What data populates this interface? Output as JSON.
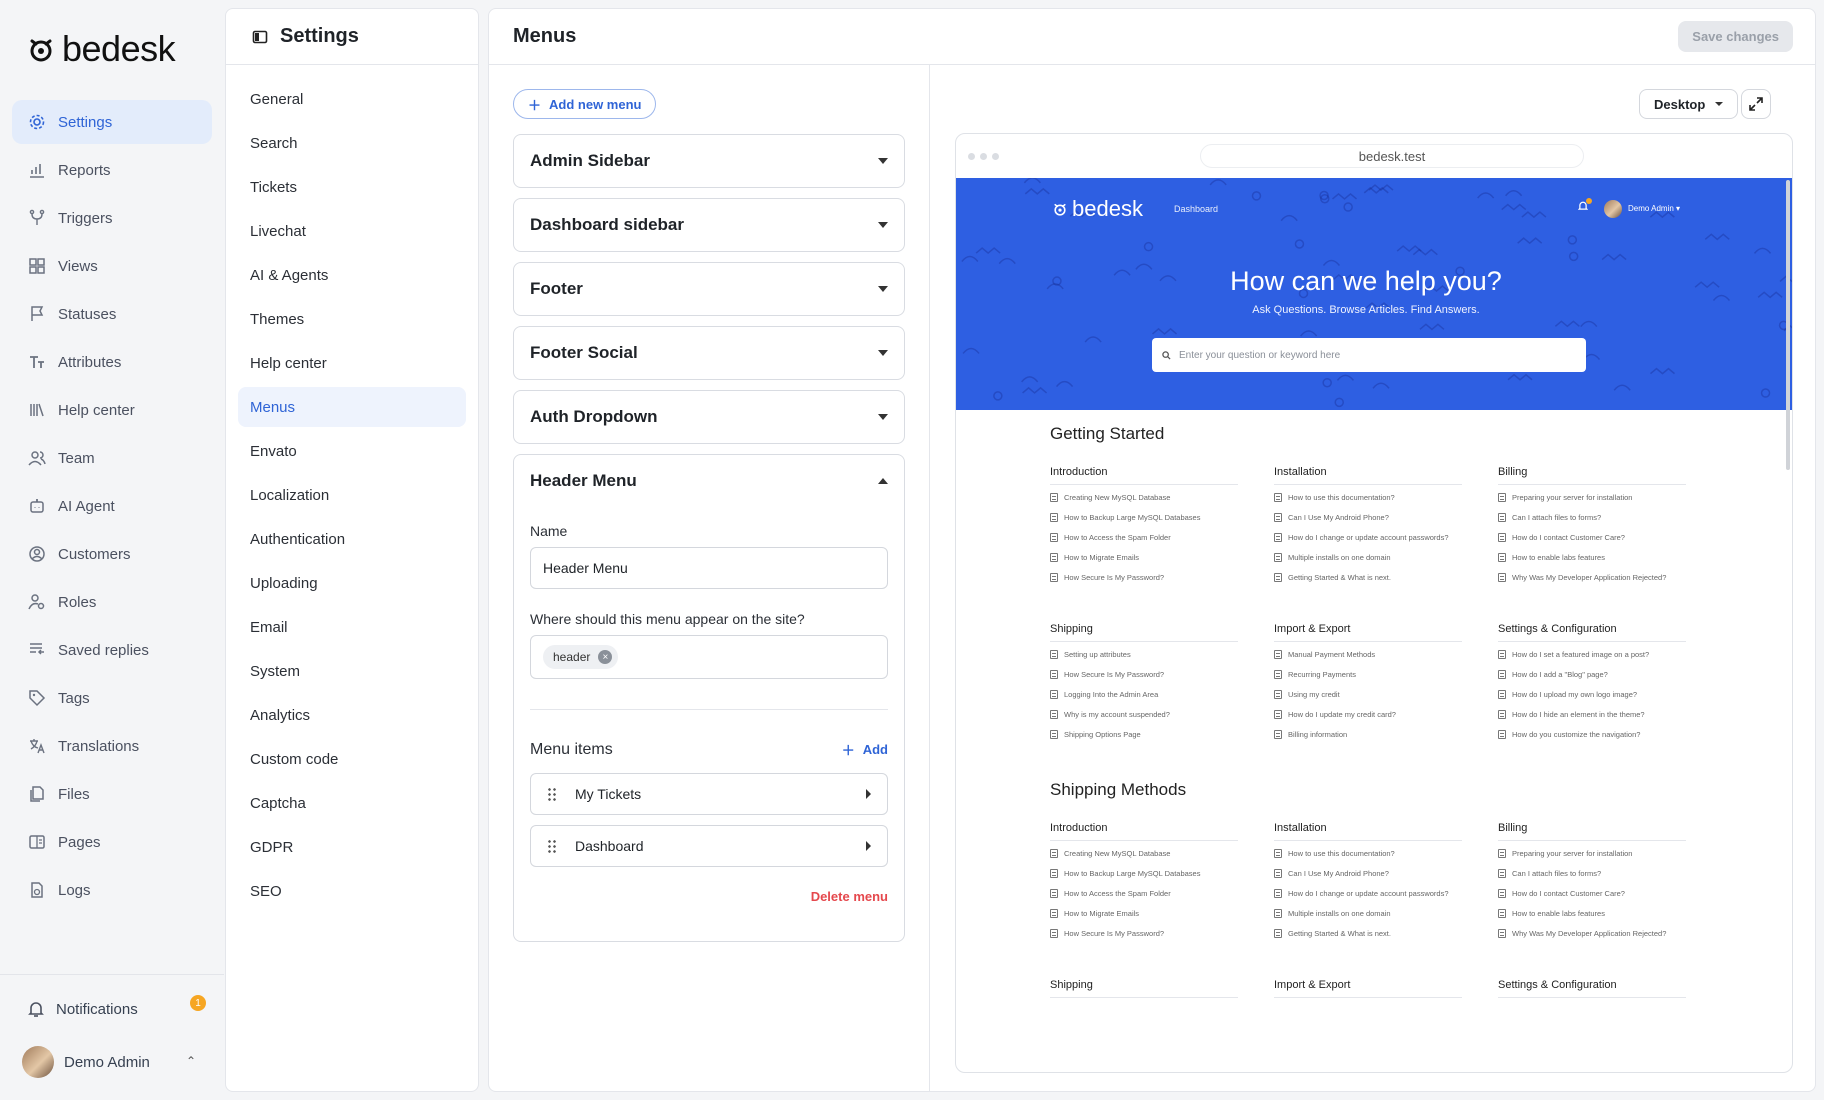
{
  "brand": {
    "name": "bedesk"
  },
  "nav": {
    "items": [
      {
        "label": "Settings",
        "icon": "gear-icon",
        "active": true
      },
      {
        "label": "Reports",
        "icon": "chart-icon"
      },
      {
        "label": "Triggers",
        "icon": "branch-icon"
      },
      {
        "label": "Views",
        "icon": "grid-icon"
      },
      {
        "label": "Statuses",
        "icon": "flag-icon"
      },
      {
        "label": "Attributes",
        "icon": "text-size-icon"
      },
      {
        "label": "Help center",
        "icon": "books-icon"
      },
      {
        "label": "Team",
        "icon": "users-icon"
      },
      {
        "label": "AI Agent",
        "icon": "robot-icon"
      },
      {
        "label": "Customers",
        "icon": "user-circle-icon"
      },
      {
        "label": "Roles",
        "icon": "user-gear-icon"
      },
      {
        "label": "Saved replies",
        "icon": "reply-icon"
      },
      {
        "label": "Tags",
        "icon": "tag-icon"
      },
      {
        "label": "Translations",
        "icon": "translate-icon"
      },
      {
        "label": "Files",
        "icon": "files-icon"
      },
      {
        "label": "Pages",
        "icon": "page-icon"
      },
      {
        "label": "Logs",
        "icon": "logs-icon"
      }
    ],
    "notifications": {
      "label": "Notifications",
      "count": "1"
    },
    "user": {
      "name": "Demo Admin"
    }
  },
  "settings": {
    "title": "Settings",
    "items": [
      "General",
      "Search",
      "Tickets",
      "Livechat",
      "AI & Agents",
      "Themes",
      "Help center",
      "Menus",
      "Envato",
      "Localization",
      "Authentication",
      "Uploading",
      "Email",
      "System",
      "Analytics",
      "Custom code",
      "Captcha",
      "GDPR",
      "SEO"
    ],
    "active": "Menus"
  },
  "main": {
    "title": "Menus",
    "save_label": "Save changes",
    "add_menu_label": "Add new menu",
    "menus": [
      "Admin Sidebar",
      "Dashboard sidebar",
      "Footer",
      "Footer Social",
      "Auth Dropdown"
    ],
    "open_menu": {
      "title": "Header Menu",
      "name_label": "Name",
      "name_value": "Header Menu",
      "position_label": "Where should this menu appear on the site?",
      "position_tag": "header",
      "items_label": "Menu items",
      "add_label": "Add",
      "items": [
        "My Tickets",
        "Dashboard"
      ],
      "delete_label": "Delete menu"
    }
  },
  "preview": {
    "device": "Desktop",
    "url": "bedesk.test",
    "brand": "bedesk",
    "nav_link": "Dashboard",
    "user": "Demo Admin",
    "hero_title": "How can we help you?",
    "hero_subtitle": "Ask Questions. Browse Articles. Find Answers.",
    "search_placeholder": "Enter your question or keyword here",
    "sections": [
      {
        "title": "Getting Started",
        "columns": [
          {
            "title": "Introduction",
            "articles": [
              "Creating New MySQL Database",
              "How to Backup Large MySQL Databases",
              "How to Access the Spam Folder",
              "How to Migrate Emails",
              "How Secure Is My Password?"
            ]
          },
          {
            "title": "Installation",
            "articles": [
              "How to use this documentation?",
              "Can I Use My Android Phone?",
              "How do I change or update account passwords?",
              "Multiple installs on one domain",
              "Getting Started & What is next."
            ]
          },
          {
            "title": "Billing",
            "articles": [
              "Preparing your server for installation",
              "Can I attach files to forms?",
              "How do I contact Customer Care?",
              "How to enable labs features",
              "Why Was My Developer Application Rejected?"
            ]
          }
        ]
      },
      {
        "title": "",
        "columns": [
          {
            "title": "Shipping",
            "articles": [
              "Setting up attributes",
              "How Secure Is My Password?",
              "Logging Into the Admin Area",
              "Why is my account suspended?",
              "Shipping Options Page"
            ]
          },
          {
            "title": "Import & Export",
            "articles": [
              "Manual Payment Methods",
              "Recurring Payments",
              "Using my credit",
              "How do I update my credit card?",
              "Billing information"
            ]
          },
          {
            "title": "Settings & Configuration",
            "articles": [
              "How do I set a featured image on a post?",
              "How do I add a \"Blog\" page?",
              "How do I upload my own logo image?",
              "How do I hide an element in the theme?",
              "How do you customize the navigation?"
            ]
          }
        ]
      },
      {
        "title": "Shipping Methods",
        "columns": [
          {
            "title": "Introduction",
            "articles": [
              "Creating New MySQL Database",
              "How to Backup Large MySQL Databases",
              "How to Access the Spam Folder",
              "How to Migrate Emails",
              "How Secure Is My Password?"
            ]
          },
          {
            "title": "Installation",
            "articles": [
              "How to use this documentation?",
              "Can I Use My Android Phone?",
              "How do I change or update account passwords?",
              "Multiple installs on one domain",
              "Getting Started & What is next."
            ]
          },
          {
            "title": "Billing",
            "articles": [
              "Preparing your server for installation",
              "Can I attach files to forms?",
              "How do I contact Customer Care?",
              "How to enable labs features",
              "Why Was My Developer Application Rejected?"
            ]
          }
        ]
      },
      {
        "title": "",
        "columns": [
          {
            "title": "Shipping",
            "articles": []
          },
          {
            "title": "Import & Export",
            "articles": []
          },
          {
            "title": "Settings & Configuration",
            "articles": []
          }
        ]
      }
    ]
  },
  "colors": {
    "accent": "#2f64d6",
    "hero": "#2e5fe2",
    "danger": "#e5484d",
    "badge": "#f6a623"
  }
}
